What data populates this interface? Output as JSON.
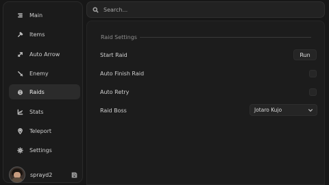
{
  "sidebar": {
    "items": [
      {
        "label": "Main",
        "icon": "list-icon"
      },
      {
        "label": "Items",
        "icon": "hammer-icon"
      },
      {
        "label": "Auto Arrow",
        "icon": "arrow-icon"
      },
      {
        "label": "Enemy",
        "icon": "sword-icon"
      },
      {
        "label": "Raids",
        "icon": "skull-icon",
        "active": true
      },
      {
        "label": "Stats",
        "icon": "chart-icon"
      },
      {
        "label": "Teleport",
        "icon": "pin-icon"
      },
      {
        "label": "Settings",
        "icon": "gear-icon"
      }
    ],
    "profile": {
      "name": "sprayd2"
    }
  },
  "search": {
    "placeholder": "Search..."
  },
  "raid": {
    "section_title": "Raid Settings",
    "start_raid_label": "Start Raid",
    "run_label": "Run",
    "auto_finish_label": "Auto Finish Raid",
    "auto_retry_label": "Auto Retry",
    "raid_boss_label": "Raid Boss",
    "raid_boss_value": "Jotaro Kujo"
  }
}
